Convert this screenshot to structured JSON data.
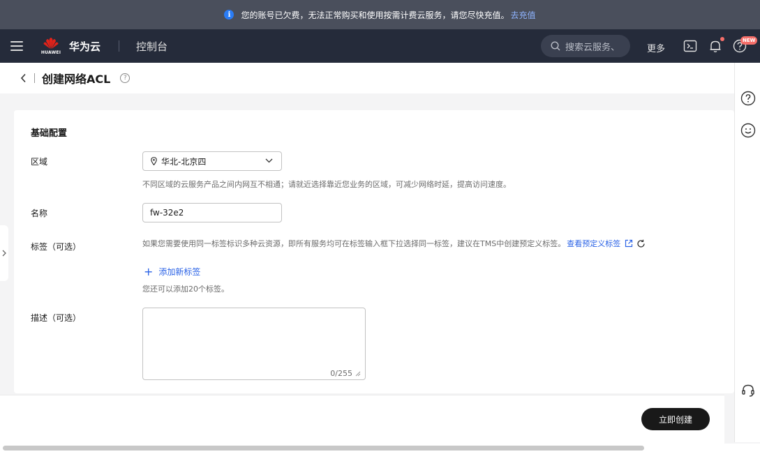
{
  "notice": {
    "text": "您的账号已欠费，无法正常购买和使用按需计费云服务，请您尽快充值。",
    "link": "去充值"
  },
  "header": {
    "logo_text": "HUAWEI",
    "brand": "华为云",
    "console": "控制台",
    "search_placeholder": "搜索云服务、",
    "more": "更多",
    "new_badge": "NEW"
  },
  "titlebar": {
    "title": "创建网络ACL",
    "help_symbol": "?"
  },
  "form": {
    "section_title": "基础配置",
    "region_label": "区域",
    "region_value": "华北-北京四",
    "region_hint": "不同区域的云服务产品之间内网互不相通；请就近选择靠近您业务的区域，可减少网络时延，提高访问速度。",
    "name_label": "名称",
    "name_value": "fw-32e2",
    "tags_label": "标签（可选）",
    "tags_hint": "如果您需要使用同一标签标识多种云资源，即所有服务均可在标签输入框下拉选择同一标签，建议在TMS中创建预定义标签。",
    "tags_link": "查看预定义标签",
    "add_tag": "添加新标签",
    "tag_limit": "您还可以添加20个标签。",
    "desc_label": "描述（可选）",
    "desc_counter": "0/255"
  },
  "footer": {
    "create": "立即创建"
  },
  "colors": {
    "header_bg": "#252b3a",
    "notice_bg": "#4a4f5c",
    "link_blue": "#2a62e6",
    "primary_btn": "#191919",
    "badge_red": "#f66f6a"
  }
}
